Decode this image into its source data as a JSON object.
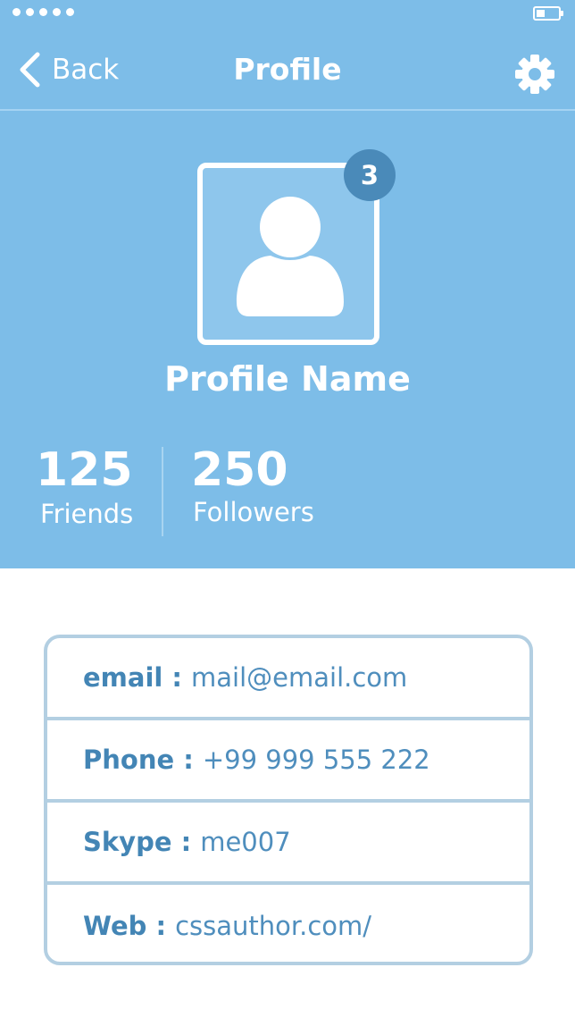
{
  "status_bar": {
    "signal_dots": 5,
    "battery_level": 0.4
  },
  "nav": {
    "back_label": "Back",
    "title": "Profile",
    "back_icon": "chevron-left-icon",
    "settings_icon": "gear-icon"
  },
  "profile": {
    "avatar_icon": "user-icon",
    "badge_count": "3",
    "name": "Profile Name"
  },
  "stats": {
    "friends": {
      "value": "125",
      "label": "Friends"
    },
    "followers": {
      "value": "250",
      "label": "Followers"
    }
  },
  "contact": {
    "email": {
      "label": "email :",
      "value": "mail@email.com"
    },
    "phone": {
      "label": "Phone :",
      "value": "+99 999 555 222"
    },
    "skype": {
      "label": "Skype :",
      "value": "me007"
    },
    "web": {
      "label": "Web :",
      "value": "cssauthor.com/"
    }
  },
  "colors": {
    "header_bg": "#7dbde8",
    "badge_bg": "#4a8ab9",
    "card_border": "#b3cfe2",
    "label_text": "#4385b5",
    "value_text": "#4f8ebd"
  }
}
